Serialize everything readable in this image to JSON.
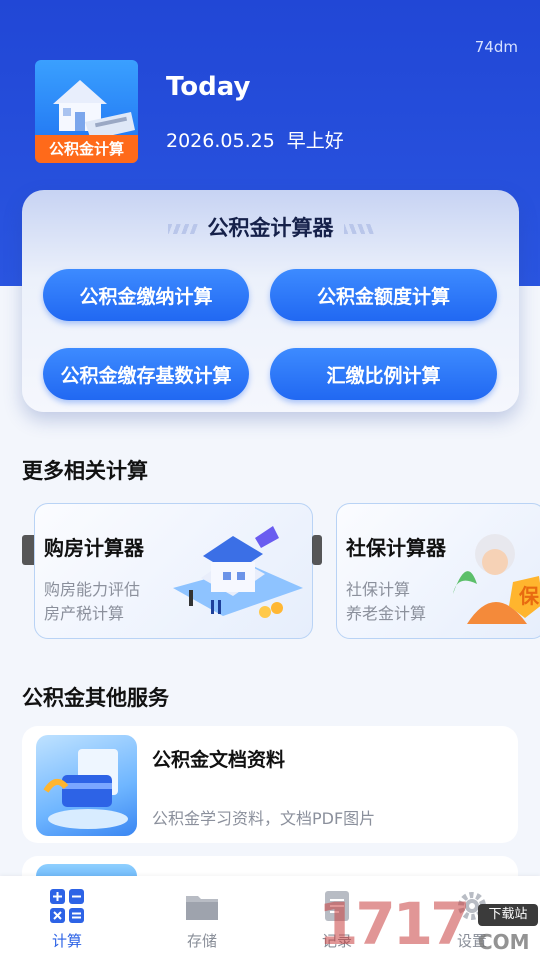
{
  "status": {
    "text": "74dm"
  },
  "header": {
    "logo_label": "公积金计算",
    "title": "Today",
    "date": "2026.05.25",
    "greeting": "早上好"
  },
  "hero": {
    "title": "公积金计算器",
    "buttons": [
      "公积金缴纳计算",
      "公积金额度计算",
      "公积金缴存基数计算",
      "汇缴比例计算"
    ]
  },
  "more": {
    "title": "更多相关计算",
    "cards": [
      {
        "title": "购房计算器",
        "lines": [
          "购房能力评估",
          "房产税计算"
        ]
      },
      {
        "title": "社保计算器",
        "lines": [
          "社保计算",
          "养老金计算"
        ],
        "badge": "保"
      }
    ]
  },
  "other": {
    "title": "公积金其他服务",
    "items": [
      {
        "title": "公积金文档资料",
        "desc": "公积金学习资料，文档PDF图片"
      }
    ]
  },
  "tabbar": {
    "items": [
      {
        "label": "计算",
        "icon": "calculator-icon",
        "active": true
      },
      {
        "label": "存储",
        "icon": "folder-icon",
        "active": false
      },
      {
        "label": "记录",
        "icon": "record-icon",
        "active": false
      },
      {
        "label": "设置",
        "icon": "gear-icon",
        "active": false
      }
    ]
  },
  "watermark": {
    "number": "1717",
    "badge": "下载站",
    "suffix": "COM"
  },
  "colors": {
    "primary": "#2147d6",
    "accent": "#2d63e6",
    "button": "#2a6ff5",
    "logo_badge": "#ff6a1a"
  }
}
